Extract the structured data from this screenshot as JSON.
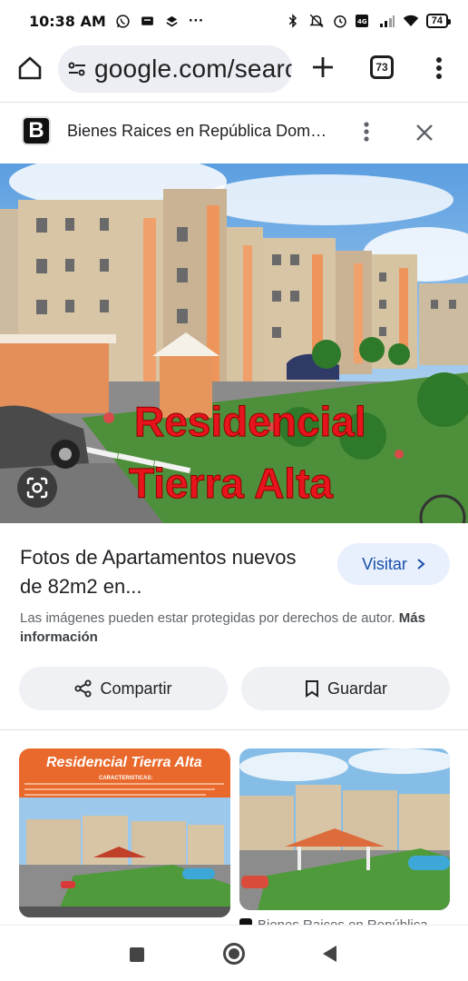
{
  "status_bar": {
    "time": "10:38 AM",
    "battery": "74",
    "overflow": "···"
  },
  "browser": {
    "url": "google.com/search",
    "tab_count": "73"
  },
  "source": {
    "logo_letter": "B",
    "title": "Bienes Raices en República Dominicana"
  },
  "image": {
    "overlay_line1": "Residencial",
    "overlay_line2": "Tierra Alta"
  },
  "result": {
    "title": "Fotos de Apartamentos nuevos de 82m2 en...",
    "visit_label": "Visitar",
    "copyright_text": "Las imágenes pueden estar protegidas por derechos de autor.",
    "copyright_link": "Más información",
    "share_label": "Compartir",
    "save_label": "Guardar"
  },
  "related": {
    "thumb1_banner": "Residencial Tierra Alta",
    "thumb1_subtitle": "CARACTERISTICAS:",
    "thumb2_caption": "Bienes Raices en República"
  },
  "colors": {
    "accent": "#1a73e8",
    "visit_bg": "#e8f0fe",
    "overlay_red": "#e8141c"
  }
}
